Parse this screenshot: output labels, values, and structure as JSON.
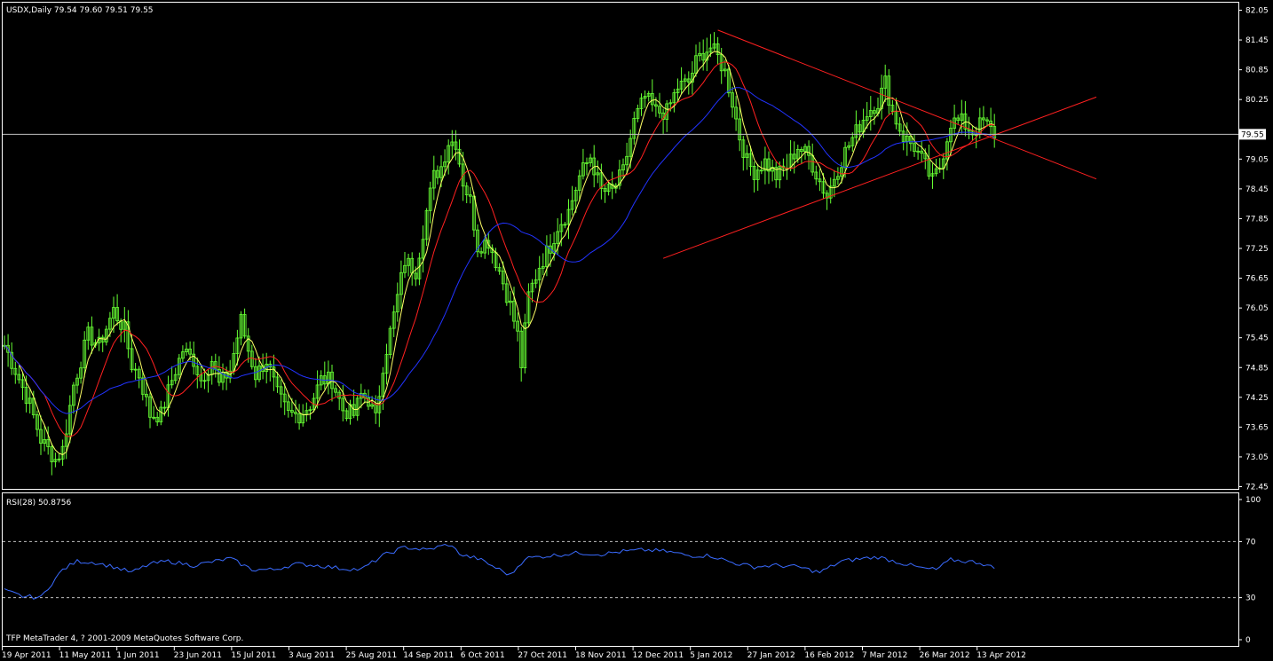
{
  "symbol_header": "USDX,Daily  79.54 79.60 79.51 79.55",
  "rsi_header": "RSI(28) 50.8756",
  "footer": "TFP MetaTrader 4, ? 2001-2009 MetaQuotes Software Corp.",
  "current_price_label": "79.55",
  "colors": {
    "background": "#000000",
    "frame": "#ffffff",
    "candles": "#66ff33",
    "ma_fast": "#ffff66",
    "ma_mid": "#ff2020",
    "ma_slow": "#2233ff",
    "trendlines": "#ff2020",
    "rsi_line": "#3a6bff",
    "price_line": "#c0c0c0",
    "rsi_levels": "#c0c0c0"
  },
  "chart_data": [
    {
      "type": "candlestick",
      "title": "USDX,Daily",
      "ohlc_header": [
        79.54,
        79.6,
        79.51,
        79.55
      ],
      "ylim": [
        72.45,
        82.05
      ],
      "y_ticks": [
        "82.05",
        "81.45",
        "80.85",
        "80.25",
        "79.05",
        "78.45",
        "77.85",
        "77.25",
        "76.65",
        "76.05",
        "75.45",
        "74.85",
        "74.25",
        "73.65",
        "73.05",
        "72.45"
      ],
      "x_ticks": [
        "19 Apr 2011",
        "11 May 2011",
        "1 Jun 2011",
        "23 Jun 2011",
        "15 Jul 2011",
        "3 Aug 2011",
        "25 Aug 2011",
        "14 Sep 2011",
        "6 Oct 2011",
        "27 Oct 2011",
        "18 Nov 2011",
        "12 Dec 2011",
        "5 Jan 2012",
        "27 Jan 2012",
        "16 Feb 2012",
        "7 Mar 2012",
        "26 Mar 2012",
        "13 Apr 2012"
      ],
      "current_price": 79.55,
      "close_path": [
        [
          0,
          75.3
        ],
        [
          3,
          74.8
        ],
        [
          7,
          74.1
        ],
        [
          10,
          73.4
        ],
        [
          14,
          73.0
        ],
        [
          16,
          73.2
        ],
        [
          19,
          74.5
        ],
        [
          23,
          75.5
        ],
        [
          26,
          75.3
        ],
        [
          30,
          76.0
        ],
        [
          33,
          75.6
        ],
        [
          35,
          74.9
        ],
        [
          37,
          74.7
        ],
        [
          40,
          73.9
        ],
        [
          43,
          73.9
        ],
        [
          46,
          74.6
        ],
        [
          49,
          75.2
        ],
        [
          52,
          75.0
        ],
        [
          54,
          74.6
        ],
        [
          57,
          75.0
        ],
        [
          59,
          74.5
        ],
        [
          62,
          74.8
        ],
        [
          65,
          75.8
        ],
        [
          67,
          75.2
        ],
        [
          69,
          74.7
        ],
        [
          72,
          75.0
        ],
        [
          75,
          74.3
        ],
        [
          78,
          73.9
        ],
        [
          81,
          73.9
        ],
        [
          84,
          74.1
        ],
        [
          87,
          74.6
        ],
        [
          90,
          74.6
        ],
        [
          93,
          74.0
        ],
        [
          96,
          73.9
        ],
        [
          98,
          74.3
        ],
        [
          100,
          74.2
        ],
        [
          102,
          73.8
        ],
        [
          104,
          74.9
        ],
        [
          107,
          75.9
        ],
        [
          110,
          77.0
        ],
        [
          113,
          76.8
        ],
        [
          116,
          78.0
        ],
        [
          118,
          78.7
        ],
        [
          120,
          78.9
        ],
        [
          122,
          79.4
        ],
        [
          124,
          79.4
        ],
        [
          126,
          78.6
        ],
        [
          128,
          78.2
        ],
        [
          130,
          77.3
        ],
        [
          133,
          77.4
        ],
        [
          136,
          76.8
        ],
        [
          139,
          76.1
        ],
        [
          141,
          75.5
        ],
        [
          142,
          74.9
        ],
        [
          144,
          76.3
        ],
        [
          147,
          76.9
        ],
        [
          150,
          77.3
        ],
        [
          152,
          77.7
        ],
        [
          155,
          78.0
        ],
        [
          158,
          78.7
        ],
        [
          161,
          79.1
        ],
        [
          164,
          78.4
        ],
        [
          167,
          78.4
        ],
        [
          170,
          78.8
        ],
        [
          173,
          79.8
        ],
        [
          176,
          80.3
        ],
        [
          179,
          80.0
        ],
        [
          182,
          80.0
        ],
        [
          185,
          80.5
        ],
        [
          188,
          80.6
        ],
        [
          190,
          81.0
        ],
        [
          192,
          81.2
        ],
        [
          194,
          81.3
        ],
        [
          196,
          81.1
        ],
        [
          198,
          80.8
        ],
        [
          200,
          80.2
        ],
        [
          202,
          79.5
        ],
        [
          204,
          79.0
        ],
        [
          206,
          78.8
        ],
        [
          209,
          79.0
        ],
        [
          212,
          78.7
        ],
        [
          215,
          78.9
        ],
        [
          218,
          79.3
        ],
        [
          221,
          79.1
        ],
        [
          224,
          78.6
        ],
        [
          226,
          78.3
        ],
        [
          228,
          78.7
        ],
        [
          231,
          79.2
        ],
        [
          234,
          79.6
        ],
        [
          237,
          80.0
        ],
        [
          240,
          80.2
        ],
        [
          242,
          80.6
        ],
        [
          244,
          80.0
        ],
        [
          247,
          79.5
        ],
        [
          250,
          79.3
        ],
        [
          253,
          78.9
        ],
        [
          255,
          78.6
        ],
        [
          257,
          78.9
        ],
        [
          260,
          79.8
        ],
        [
          263,
          79.8
        ],
        [
          266,
          79.6
        ],
        [
          269,
          79.8
        ],
        [
          272,
          79.55
        ]
      ],
      "trendlines": [
        {
          "from": [
            196,
            81.65
          ],
          "to": [
            300,
            78.65
          ]
        },
        {
          "from": [
            181,
            77.05
          ],
          "to": [
            300,
            80.3
          ]
        }
      ]
    },
    {
      "type": "line",
      "title": "RSI(28)",
      "value": 50.8756,
      "ylim": [
        0,
        100
      ],
      "y_ticks": [
        "100",
        "70",
        "30",
        "0"
      ],
      "levels": [
        30,
        70
      ],
      "rsi_path": [
        [
          0,
          35
        ],
        [
          5,
          31
        ],
        [
          10,
          30
        ],
        [
          12,
          37
        ],
        [
          16,
          50
        ],
        [
          20,
          56
        ],
        [
          25,
          55
        ],
        [
          30,
          52
        ],
        [
          35,
          48
        ],
        [
          40,
          54
        ],
        [
          45,
          56
        ],
        [
          52,
          53
        ],
        [
          58,
          56
        ],
        [
          62,
          58
        ],
        [
          68,
          50
        ],
        [
          74,
          50
        ],
        [
          80,
          54
        ],
        [
          86,
          53
        ],
        [
          92,
          51
        ],
        [
          98,
          50
        ],
        [
          104,
          60
        ],
        [
          110,
          66
        ],
        [
          116,
          64
        ],
        [
          122,
          68
        ],
        [
          126,
          60
        ],
        [
          130,
          58
        ],
        [
          136,
          50
        ],
        [
          139,
          46
        ],
        [
          143,
          58
        ],
        [
          150,
          60
        ],
        [
          158,
          62
        ],
        [
          164,
          61
        ],
        [
          170,
          63
        ],
        [
          176,
          64
        ],
        [
          182,
          63
        ],
        [
          188,
          60
        ],
        [
          194,
          60
        ],
        [
          200,
          55
        ],
        [
          206,
          52
        ],
        [
          212,
          53
        ],
        [
          218,
          52
        ],
        [
          224,
          48
        ],
        [
          230,
          56
        ],
        [
          236,
          58
        ],
        [
          240,
          59
        ],
        [
          246,
          55
        ],
        [
          252,
          51
        ],
        [
          256,
          50
        ],
        [
          260,
          57
        ],
        [
          264,
          56
        ],
        [
          268,
          55
        ],
        [
          272,
          51
        ]
      ]
    }
  ]
}
